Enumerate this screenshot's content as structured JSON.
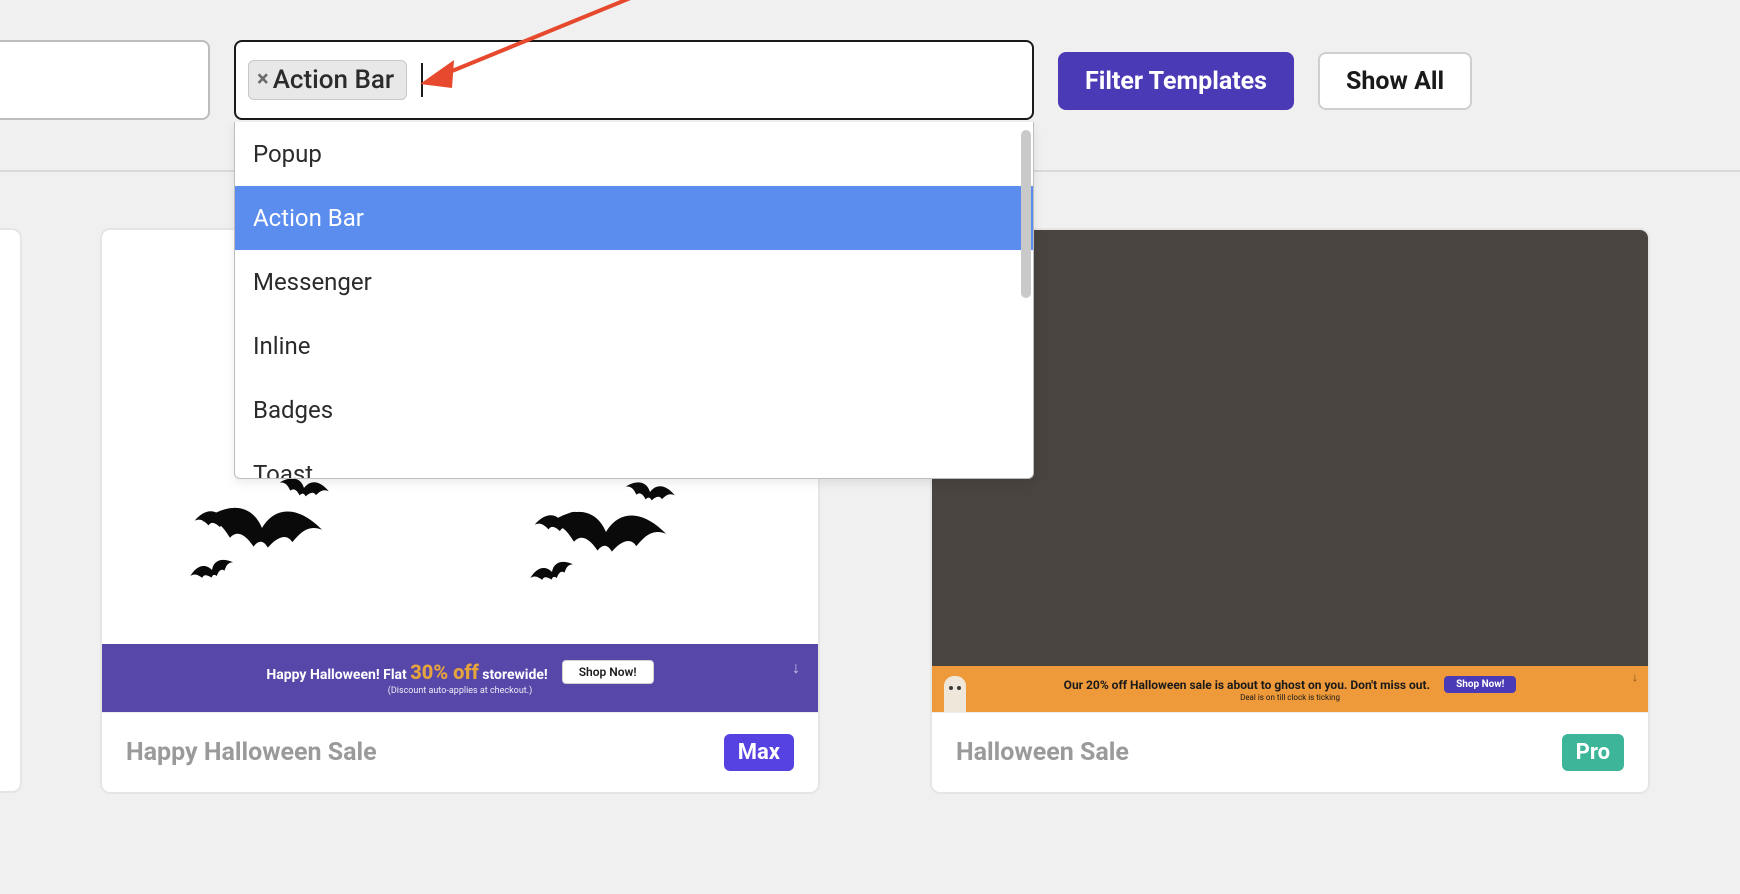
{
  "filters": {
    "selected_tag": "Action Bar",
    "options": [
      "Popup",
      "Action Bar",
      "Messenger",
      "Inline",
      "Badges",
      "Toast"
    ],
    "selected_index": 1
  },
  "buttons": {
    "filter": "Filter Templates",
    "show_all": "Show All"
  },
  "cards": [
    {
      "title": "Happy Halloween Sale",
      "plan": "Max",
      "banner": {
        "text_pre": "Happy Halloween! Flat",
        "pct": "30% off",
        "text_post": "storewide!",
        "cta": "Shop Now!",
        "sub": "(Discount auto-applies at checkout.)"
      }
    },
    {
      "title": "Halloween Sale",
      "plan": "Pro",
      "banner": {
        "text": "Our 20% off Halloween sale is about to ghost on you. Don't miss out.",
        "cta": "Shop Now!",
        "sub": "Deal is on till clock is ticking"
      }
    }
  ]
}
